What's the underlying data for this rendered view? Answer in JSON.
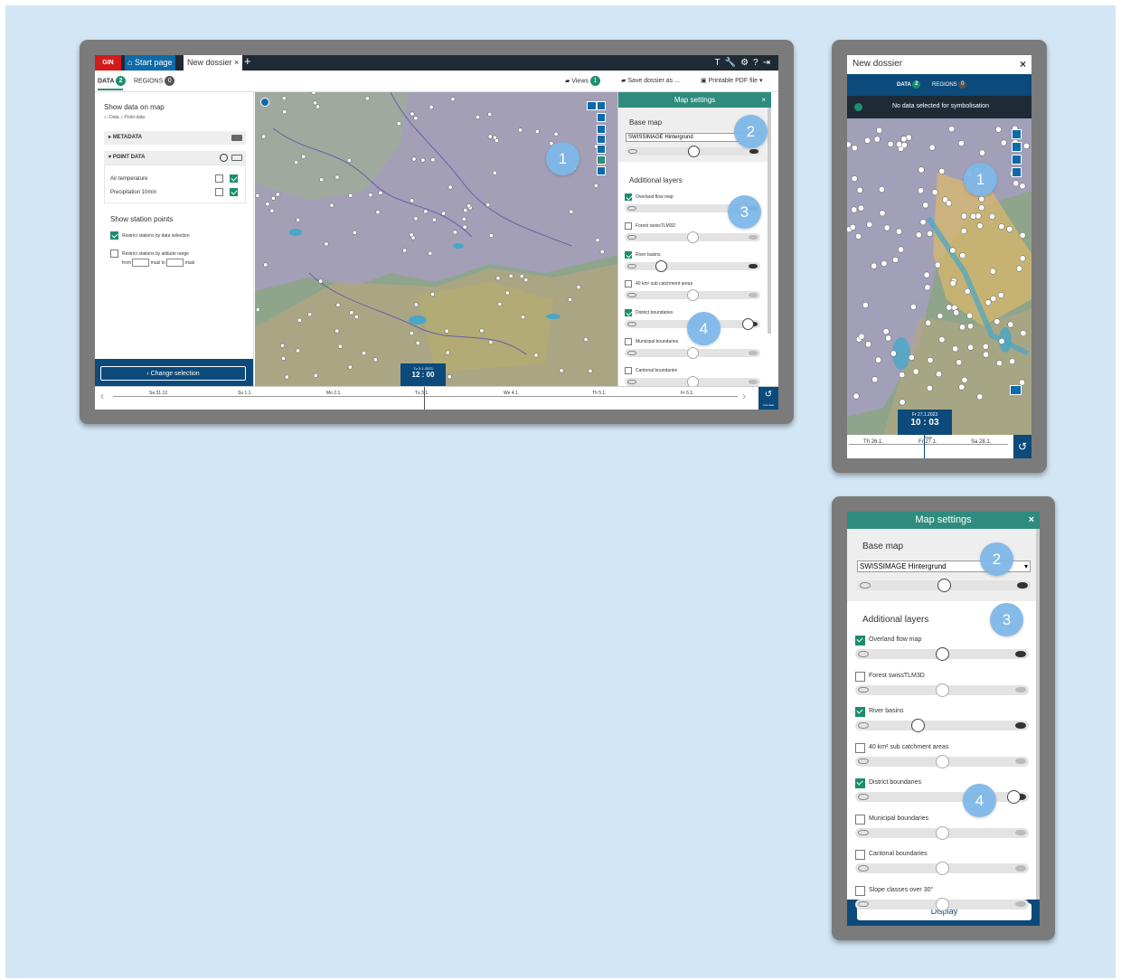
{
  "desktop": {
    "logo": "GIN",
    "start_page": "Start page",
    "tab_title": "New dossier",
    "tab_close": "×",
    "new_tab": "+",
    "tools": "T🔧⚙?⇥",
    "subtabs": [
      {
        "label": "DATA",
        "count": "2"
      },
      {
        "label": "REGIONS",
        "count": "0"
      }
    ],
    "views_label": "Views",
    "views_count": "1",
    "save_label": "Save dossier as ...",
    "pdf_label": "Printable PDF file",
    "sidebar": {
      "title": "Show data on map",
      "legend_data": "Data",
      "legend_point": "Point data",
      "metadata": "METADATA",
      "point_data": "POINT DATA",
      "rows": [
        "Air temperature",
        "Precipitation 10min"
      ],
      "station_title": "Show station points",
      "restrict_data": "Restrict stations by data selection",
      "restrict_alt": "Restrict stations by altitude range",
      "from": "from",
      "masl1": "masl",
      "to": "to",
      "masl2": "masl",
      "change_selection": "‹ Change selection"
    },
    "time": {
      "date": "Tu 3.1.2023",
      "time": "12 : 00"
    },
    "timeline_days": [
      "Sa 31.12.",
      "Su 1.1.",
      "Mo 2.1.",
      "Tu 3.1.",
      "We 4.1.",
      "Th 5.1.",
      "Fr 6.1."
    ],
    "live_label": "Live data",
    "map_settings": {
      "title": "Map settings",
      "close": "×",
      "base_map": "Base map",
      "base_value": "SWISSIMAGE Hintergrund",
      "additional": "Additional layers",
      "layers": [
        {
          "name": "Overland flow map",
          "on": true,
          "level": 0.9
        },
        {
          "name": "Forest swissTLM3D",
          "on": false,
          "level": 0.5
        },
        {
          "name": "River basins",
          "on": true,
          "level": 0.25
        },
        {
          "name": "40 km² sub catchment areas",
          "on": false,
          "level": 0.5
        },
        {
          "name": "District boundaries",
          "on": true,
          "level": 0.95
        },
        {
          "name": "Municipal boundaries",
          "on": false,
          "level": 0.5
        },
        {
          "name": "Cantonal boundaries",
          "on": false,
          "level": 0.5
        }
      ]
    }
  },
  "mobile": {
    "title": "New dossier",
    "close": "×",
    "tabs": [
      {
        "label": "DATA",
        "count": "2"
      },
      {
        "label": "REGIONS",
        "count": "0"
      }
    ],
    "notice": "No data selected for symbolisation",
    "time": {
      "date": "Fr 27.1.2023",
      "time": "10 : 03"
    },
    "now": "Now",
    "timeline_days": [
      "Th 26.1.",
      "Fr 27.1.",
      "Sa 28.1."
    ]
  },
  "mobile_settings": {
    "title": "Map settings",
    "close": "×",
    "base_map": "Base map",
    "base_value": "SWISSIMAGE Hintergrund",
    "additional": "Additional layers",
    "layers": [
      {
        "name": "Overland flow map",
        "on": true,
        "level": 0.5
      },
      {
        "name": "Forest swissTLM3D",
        "on": false,
        "level": 0.5
      },
      {
        "name": "River basins",
        "on": true,
        "level": 0.35
      },
      {
        "name": "40 km² sub catchment areas",
        "on": false,
        "level": 0.5
      },
      {
        "name": "District boundaries",
        "on": true,
        "level": 0.95
      },
      {
        "name": "Municipal boundaries",
        "on": false,
        "level": 0.5
      },
      {
        "name": "Cantonal boundaries",
        "on": false,
        "level": 0.5
      },
      {
        "name": "Slope classes over 30°",
        "on": false,
        "level": 0.5
      }
    ],
    "display": "Display"
  },
  "callouts": [
    "1",
    "2",
    "3",
    "4"
  ],
  "colors": {
    "teal": "#2e8b7e",
    "navy": "#0b4a7a",
    "callout": "#7fb8e8",
    "bg": "#d3e6f5"
  }
}
